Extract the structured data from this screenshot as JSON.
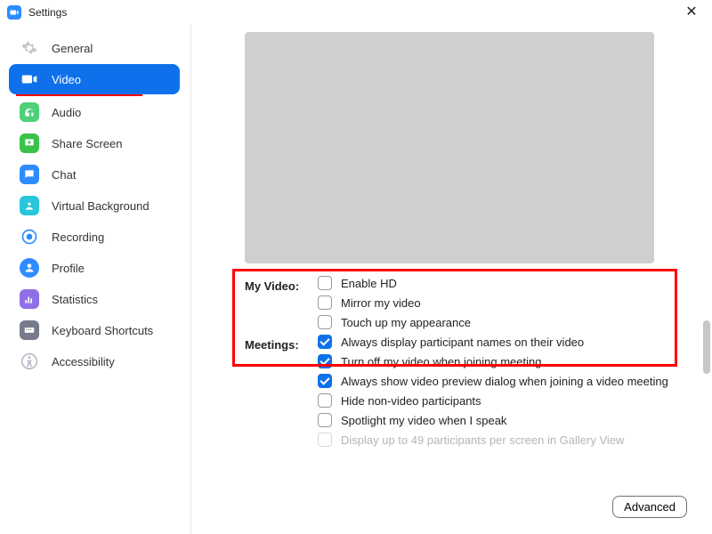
{
  "window": {
    "title": "Settings"
  },
  "sidebar": {
    "items": [
      {
        "label": "General",
        "active": false
      },
      {
        "label": "Video",
        "active": true
      },
      {
        "label": "Audio",
        "active": false
      },
      {
        "label": "Share Screen",
        "active": false
      },
      {
        "label": "Chat",
        "active": false
      },
      {
        "label": "Virtual Background",
        "active": false
      },
      {
        "label": "Recording",
        "active": false
      },
      {
        "label": "Profile",
        "active": false
      },
      {
        "label": "Statistics",
        "active": false
      },
      {
        "label": "Keyboard Shortcuts",
        "active": false
      },
      {
        "label": "Accessibility",
        "active": false
      }
    ]
  },
  "sections": {
    "myVideo": {
      "title": "My Video:",
      "options": [
        {
          "label": "Enable HD",
          "checked": false
        },
        {
          "label": "Mirror my video",
          "checked": false
        },
        {
          "label": "Touch up my appearance",
          "checked": false
        }
      ]
    },
    "meetings": {
      "title": "Meetings:",
      "options": [
        {
          "label": "Always display participant names on their video",
          "checked": true
        },
        {
          "label": "Turn off my video when joining meeting",
          "checked": true
        },
        {
          "label": "Always show video preview dialog when joining a video meeting",
          "checked": true
        },
        {
          "label": "Hide non-video participants",
          "checked": false
        },
        {
          "label": "Spotlight my video when I speak",
          "checked": false
        },
        {
          "label": "Display up to 49 participants per screen in Gallery View",
          "checked": false,
          "disabled": true
        }
      ]
    }
  },
  "buttons": {
    "advanced": "Advanced"
  },
  "colors": {
    "accent": "#0E71EB",
    "annotation": "#ff0000"
  }
}
